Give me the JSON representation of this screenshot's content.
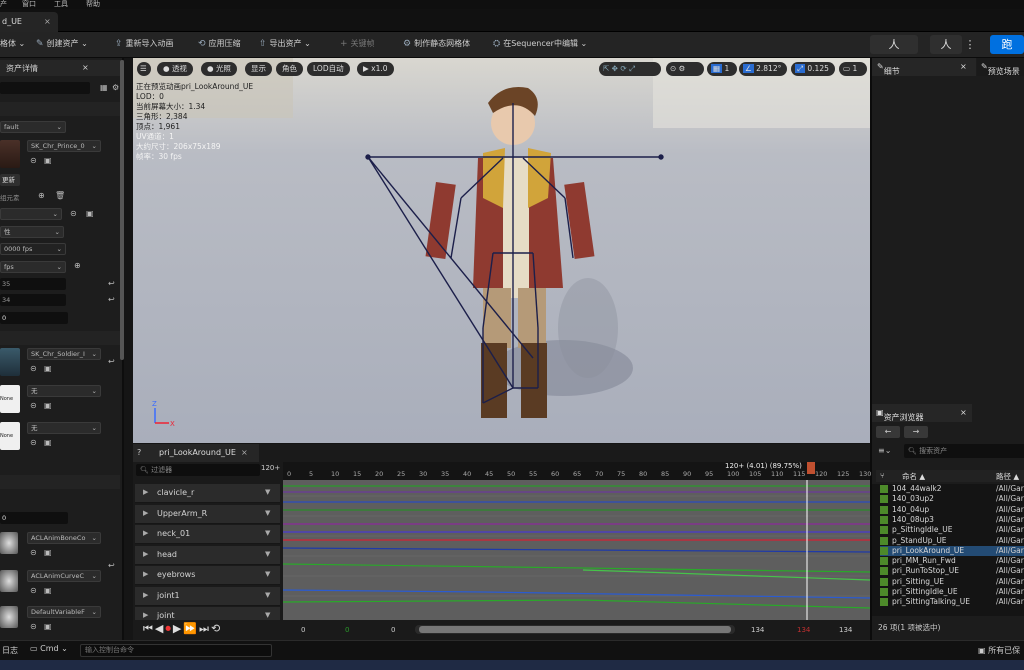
{
  "menu": {
    "items": [
      "产",
      "窗口",
      "工具",
      "帮助"
    ]
  },
  "doc_tab": {
    "label": "d_UE",
    "close": "×"
  },
  "toolbar": {
    "items": [
      "格体",
      "创建资产",
      "重新导入动画",
      "应用压缩",
      "导出资产",
      "关键帧",
      "制作静态网格体",
      "在Sequencer中编辑"
    ],
    "modes": [
      "人",
      "人",
      "⋮",
      "跑"
    ]
  },
  "left_panel": {
    "title": "资产详情",
    "close": "×",
    "lod_value": "fault",
    "mesh_name": "SK_Chr_Prince_0",
    "update_btn": "更新",
    "add_elem": "组元素",
    "fps1": "0000 fps",
    "prop_label": "性",
    "fps2": "fps",
    "val_a": "35",
    "val_b": "34",
    "val_c": "0",
    "soldier": "SK_Chr_Soldier_I",
    "none1": "None",
    "none_dd1": "无",
    "none2": "None",
    "none_dd2": "无",
    "val_d": "0",
    "codec1": "ACLAnimBoneCo",
    "codec2": "ACLAnimCurveC",
    "codec3": "DefaultVariableF"
  },
  "viewport": {
    "pills": [
      "透视",
      "光照",
      "显示",
      "角色",
      "LOD自动",
      "x1.0"
    ],
    "right_controls": [
      "1",
      "2.812°",
      "0.125",
      "1"
    ],
    "info": [
      "正在预览动画pri_LookAround_UE",
      "LOD：0",
      "当前屏幕大小：1.34",
      "三角形：2,384",
      "顶点：1,961",
      "UV通道：1",
      "大约尺寸：206x75x189",
      "帧率：30 fps"
    ]
  },
  "right_panel": {
    "details_tab": "细节",
    "preview_tab": "预览场景",
    "close": "×",
    "browser_title": "资产浏览器",
    "search_placeholder": "搜索资产",
    "col_name": "命名",
    "col_path": "路径",
    "assets": [
      {
        "name": "104_44walk2",
        "path": "/All/Gar"
      },
      {
        "name": "140_03up2",
        "path": "/All/Gar"
      },
      {
        "name": "140_04up",
        "path": "/All/Gar"
      },
      {
        "name": "140_08up3",
        "path": "/All/Gar"
      },
      {
        "name": "p_SittingIdle_UE",
        "path": "/All/Gar"
      },
      {
        "name": "p_StandUp_UE",
        "path": "/All/Gar"
      },
      {
        "name": "pri_LookAround_UE",
        "path": "/All/Gar"
      },
      {
        "name": "pri_MM_Run_Fwd",
        "path": "/All/Gar"
      },
      {
        "name": "pri_RunToStop_UE",
        "path": "/All/Gar"
      },
      {
        "name": "pri_Sitting_UE",
        "path": "/All/Gar"
      },
      {
        "name": "pri_SittingIdle_UE",
        "path": "/All/Gar"
      },
      {
        "name": "pri_SittingTalking_UE",
        "path": "/All/Gar"
      }
    ],
    "count_text": "26 项(1 项被选中)"
  },
  "anim": {
    "tab_label": "pri_LookAround_UE",
    "filter_placeholder": "过滤器",
    "frame_count": "120",
    "playhead": "120+ (4.01) (89.75%)",
    "ruler": [
      "0",
      "5",
      "10",
      "15",
      "20",
      "25",
      "30",
      "35",
      "40",
      "45",
      "50",
      "55",
      "60",
      "65",
      "70",
      "75",
      "80",
      "85",
      "90",
      "95",
      "100",
      "105",
      "110",
      "115",
      "120",
      "125",
      "130"
    ],
    "tracks": [
      "clavicle_r",
      "UpperArm_R",
      "neck_01",
      "head",
      "eyebrows",
      "joint1",
      "joint"
    ],
    "bottom": [
      "0",
      "0",
      "0",
      "134",
      "134",
      "134"
    ]
  },
  "status": {
    "log": "日志",
    "cmd": "Cmd",
    "console_placeholder": "输入控制台命令",
    "saved": "所有已保"
  },
  "colors": {
    "accent": "#0070e0",
    "selection": "#234b74",
    "asset_icon": "#4d8a2a"
  }
}
